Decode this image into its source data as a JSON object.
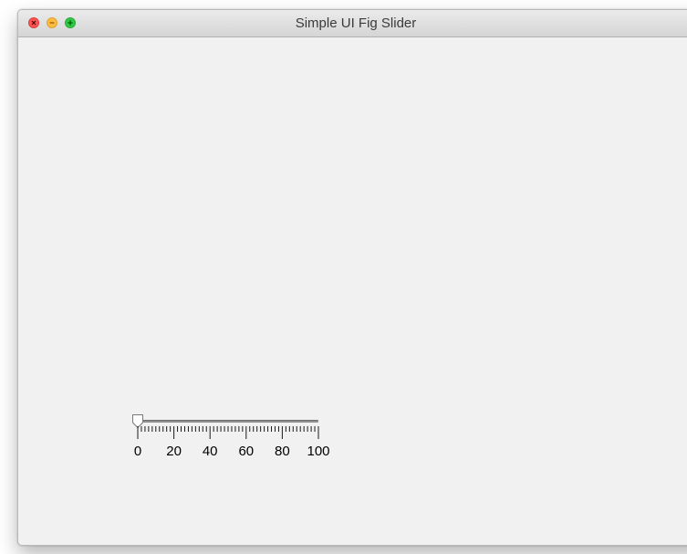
{
  "window": {
    "title": "Simple UI Fig Slider"
  },
  "slider": {
    "value": 0,
    "min": 0,
    "max": 100,
    "tick_labels": [
      "0",
      "20",
      "40",
      "60",
      "80",
      "100"
    ]
  },
  "icons": {
    "close": "close-icon",
    "minimize": "minimize-icon",
    "maximize": "maximize-icon"
  },
  "colors": {
    "close": "#fc5753",
    "minimize": "#fdbc40",
    "maximize": "#33c748",
    "window_background": "#f1f1f2"
  }
}
